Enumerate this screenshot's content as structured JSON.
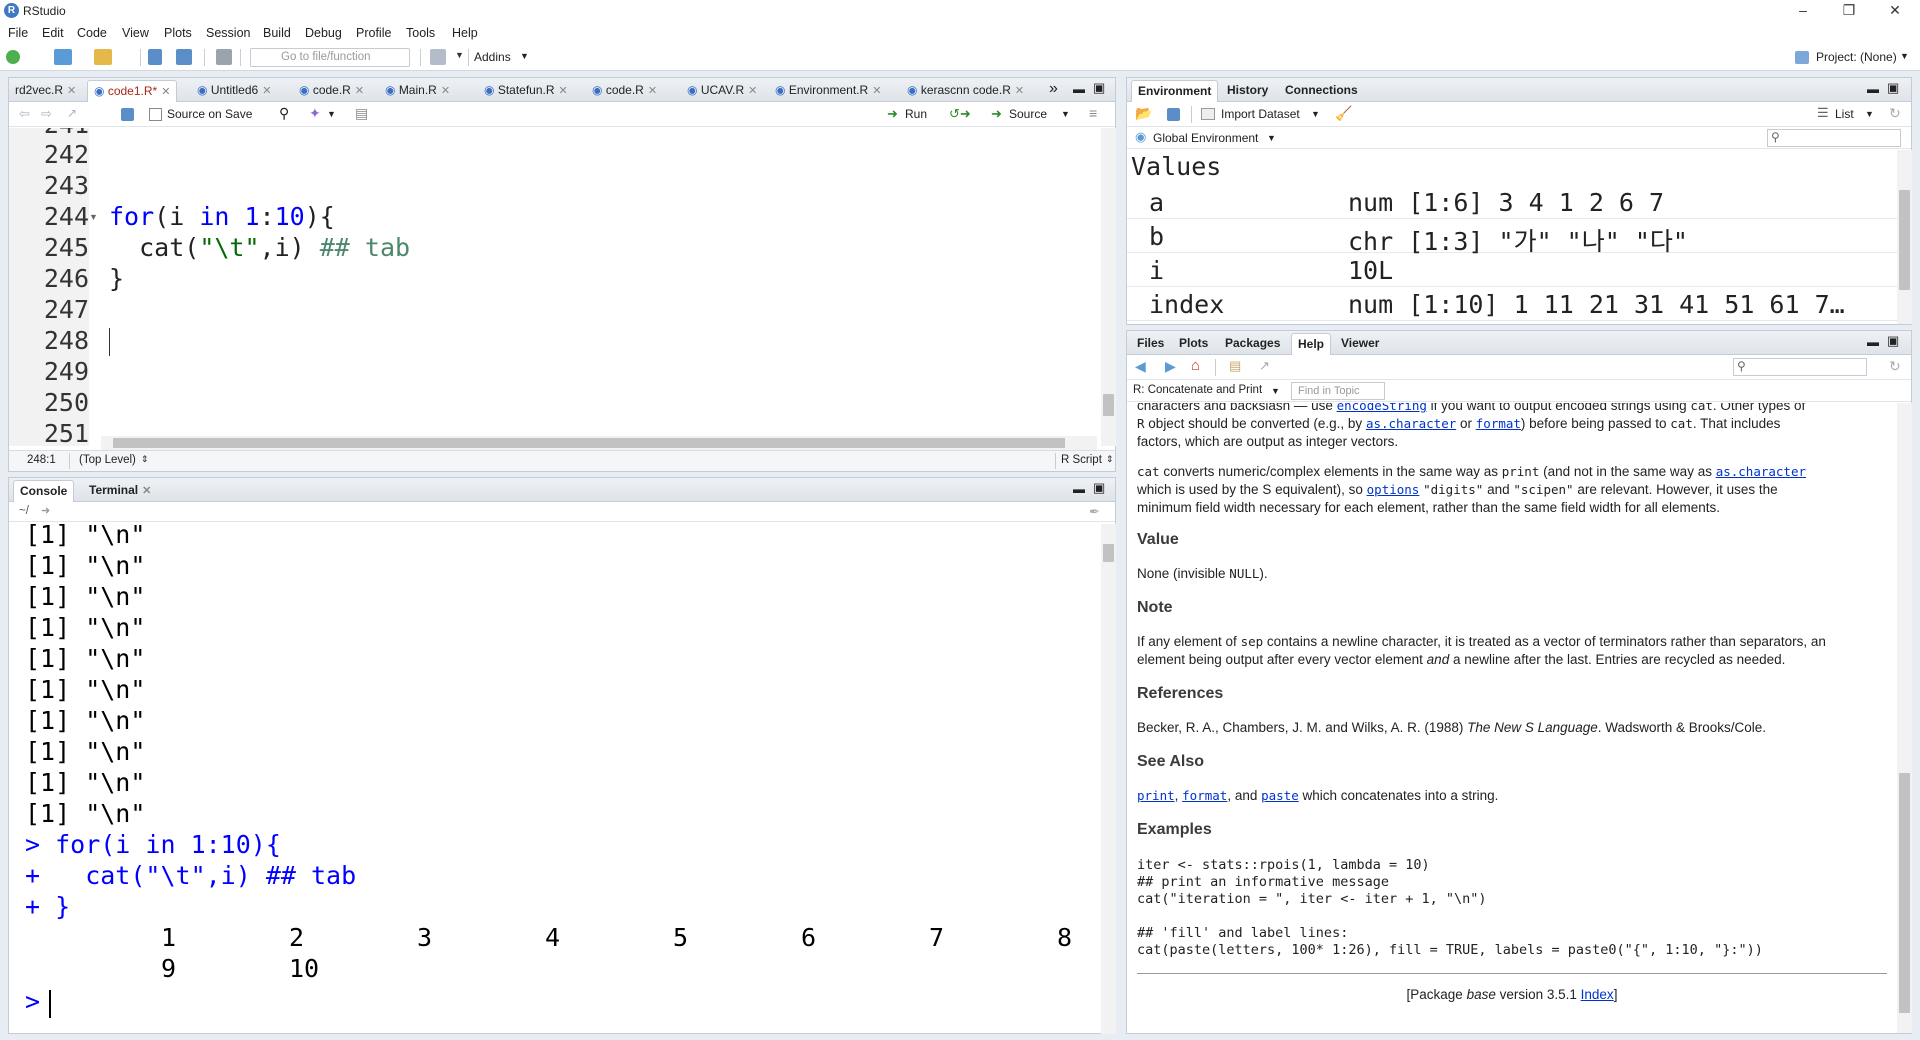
{
  "window": {
    "title": "RStudio",
    "logo": "R"
  },
  "menu": [
    "File",
    "Edit",
    "Code",
    "View",
    "Plots",
    "Session",
    "Build",
    "Debug",
    "Profile",
    "Tools",
    "Help"
  ],
  "toolbar": {
    "goto_placeholder": "Go to file/function",
    "addins": "Addins",
    "project": "Project: (None)"
  },
  "editor": {
    "tabs": [
      "rd2vec.R",
      "code1.R*",
      "Untitled6",
      "code.R",
      "Main.R",
      "Statefun.R",
      "code.R",
      "UCAV.R",
      "Environment.R",
      "kerascnn code.R"
    ],
    "source_on_save": "Source on Save",
    "run": "Run",
    "source": "Source",
    "line_numbers": [
      "242",
      "243",
      "244",
      "245",
      "246",
      "247",
      "248",
      "249",
      "250",
      "251"
    ],
    "line_numbers_top_partial": "241",
    "code": {
      "l244_a": "for",
      "l244_b": "(i ",
      "l244_c": "in",
      "l244_d": " ",
      "l244_e": "1",
      "l244_f": ":",
      "l244_g": "10",
      "l244_h": "){",
      "l245_a": "  cat(",
      "l245_b": "\"\\t\"",
      "l245_c": ",i) ",
      "l245_d": "## tab",
      "l246": "}"
    },
    "status_pos": "248:1",
    "status_scope": "(Top Level)",
    "status_type": "R Script"
  },
  "console": {
    "tabs": [
      "Console",
      "Terminal"
    ],
    "path": "~/",
    "output_lines": [
      "[1] \"\\n\"",
      "[1] \"\\n\"",
      "[1] \"\\n\"",
      "[1] \"\\n\"",
      "[1] \"\\n\"",
      "[1] \"\\n\"",
      "[1] \"\\n\"",
      "[1] \"\\n\"",
      "[1] \"\\n\"",
      "[1] \"\\n\""
    ],
    "cmd1": "> for(i in 1:10){",
    "cmd2": "+   cat(\"\\t\",i) ## tab",
    "cmd3": "+ }",
    "result_row1": [
      "1",
      "2",
      "3",
      "4",
      "5",
      "6",
      "7",
      "8"
    ],
    "result_row2": [
      "9",
      "10"
    ],
    "prompt": ">"
  },
  "environment": {
    "tabs": [
      "Environment",
      "History",
      "Connections"
    ],
    "import": "Import Dataset",
    "view_mode": "List",
    "scope": "Global Environment",
    "section": "Values",
    "rows": [
      {
        "name": "a",
        "value": "num [1:6] 3 4 1 2 6 7"
      },
      {
        "name": "b",
        "value": "chr [1:3] \"가\" \"나\" \"다\""
      },
      {
        "name": "i",
        "value": "10L"
      },
      {
        "name": "index",
        "value": "num [1:10] 1 11 21 31 41 51 61 7…"
      }
    ]
  },
  "help": {
    "tabs": [
      "Files",
      "Plots",
      "Packages",
      "Help",
      "Viewer"
    ],
    "topic": "R: Concatenate and Print",
    "find_placeholder": "Find in Topic",
    "p1_a": "characters and backslash — use ",
    "p1_link": "encodeString",
    "p1_b": " if you want to output encoded strings using ",
    "p1_code": "cat",
    "p1_c": ". Other types of",
    "p2_a": "object should be converted (e.g., by ",
    "p2_link1": "as.character",
    "p2_b": " or ",
    "p2_link2": "format",
    "p2_c": ") before being passed to ",
    "p2_code": "cat",
    "p2_d": ". That includes",
    "p3": "factors, which are output as integer vectors.",
    "p4_a": "cat",
    "p4_b": " converts numeric/complex elements in the same way as ",
    "p4_code": "print",
    "p4_c": " (and not in the same way as ",
    "p4_link": "as.character",
    "p5_a": "which is used by the S equivalent), so ",
    "p5_link": "options",
    "p5_b": " ",
    "p5_code1": "\"digits\"",
    "p5_c": " and ",
    "p5_code2": "\"scipen\"",
    "p5_d": " are relevant. However, it uses the",
    "p6": "minimum field width necessary for each element, rather than the same field width for all elements.",
    "h_value": "Value",
    "value_a": "None (invisible ",
    "value_code": "NULL",
    "value_b": ").",
    "h_note": "Note",
    "note1_a": "If any element of ",
    "note1_code": "sep",
    "note1_b": " contains a newline character, it is treated as a vector of terminators rather than separators, an",
    "note2_a": "element being output after every vector element ",
    "note2_em": "and",
    "note2_b": " a newline after the last. Entries are recycled as needed.",
    "h_refs": "References",
    "refs_a": "Becker, R. A., Chambers, J. M. and Wilks, A. R. (1988) ",
    "refs_em": "The New S Language",
    "refs_b": ". Wadsworth & Brooks/Cole.",
    "h_see": "See Also",
    "see_l1": "print",
    "see_a": ", ",
    "see_l2": "format",
    "see_b": ", and ",
    "see_l3": "paste",
    "see_c": " which concatenates into a string.",
    "h_examples": "Examples",
    "ex": [
      "iter <- stats::rpois(1, lambda = 10)",
      "## print an informative message",
      "cat(\"iteration = \", iter <- iter + 1, \"\\n\")",
      "",
      "## 'fill' and label lines:",
      "cat(paste(letters, 100* 1:26), fill = TRUE, labels = paste0(\"{\", 1:10, \"}:\"))"
    ],
    "footer_a": "[Package ",
    "footer_em": "base",
    "footer_b": " version 3.5.1 ",
    "footer_link": "Index",
    "footer_c": "]"
  }
}
